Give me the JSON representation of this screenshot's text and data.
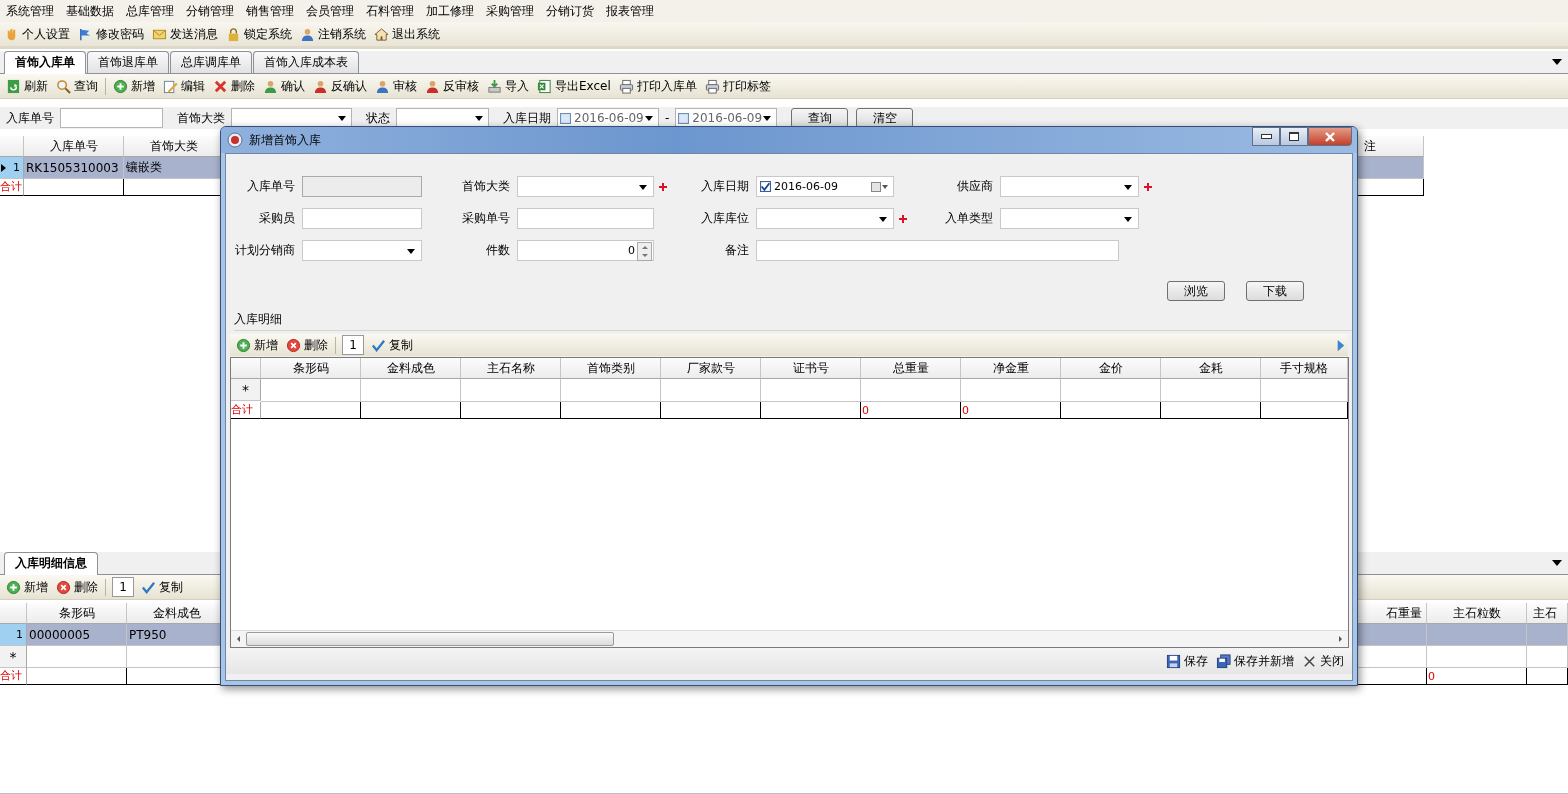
{
  "menu_bar": [
    "系统管理",
    "基础数据",
    "总库管理",
    "分销管理",
    "销售管理",
    "会员管理",
    "石料管理",
    "加工修理",
    "采购管理",
    "分销订货",
    "报表管理"
  ],
  "quick_bar": [
    "个人设置",
    "修改密码",
    "发送消息",
    "锁定系统",
    "注销系统",
    "退出系统"
  ],
  "tabs": [
    {
      "label": "首饰入库单",
      "selected": true
    },
    {
      "label": "首饰退库单",
      "selected": false
    },
    {
      "label": "总库调库单",
      "selected": false
    },
    {
      "label": "首饰入库成本表",
      "selected": false
    }
  ],
  "toolbar": [
    "刷新",
    "查询",
    "新增",
    "编辑",
    "删除",
    "确认",
    "反确认",
    "审核",
    "反审核",
    "导入",
    "导出Excel",
    "打印入库单",
    "打印标签"
  ],
  "filter": {
    "fields": [
      {
        "label": "入库单号",
        "kind": "text"
      },
      {
        "label": "首饰大类",
        "kind": "select"
      },
      {
        "label": "状态",
        "kind": "select"
      },
      {
        "label": "入库日期",
        "kind": "daterange",
        "from": {
          "value": "2016-06-09",
          "checked": false
        },
        "to": {
          "value": "2016-06-09",
          "checked": false
        },
        "separator": "-"
      }
    ],
    "buttons": [
      "查询",
      "清空"
    ]
  },
  "upper_grid": {
    "columns_left": [
      "入库单号",
      "首饰大类"
    ],
    "columns_right": [
      "注"
    ],
    "rows": [
      {
        "number": "1",
        "selected": true,
        "cells": [
          "RK1505310003",
          "镶嵌类"
        ]
      }
    ],
    "total_label": "合计"
  },
  "detail_panel": {
    "tab": "入库明细信息",
    "toolbar": {
      "add": "新增",
      "delete": "删除",
      "count": "1",
      "copy": "复制"
    },
    "columns_left": [
      {
        "label": "条形码"
      },
      {
        "label": "金料成色"
      }
    ],
    "columns_right": [
      {
        "label": "石重量"
      },
      {
        "label": "主石粒数",
        "total": "0"
      },
      {
        "label": "主石"
      }
    ],
    "rows": [
      {
        "number": "1",
        "selected": true,
        "cells": [
          "00000005",
          "PT950"
        ]
      }
    ],
    "new_row_mark": "*",
    "total_label": "合计"
  },
  "dialog": {
    "title": "新增首饰入库",
    "fields": [
      {
        "label": "入库单号",
        "kind": "text",
        "disabled": true,
        "required": false
      },
      {
        "label": "首饰大类",
        "kind": "select",
        "required": true
      },
      {
        "label": "入库日期",
        "kind": "date",
        "value": "2016-06-09",
        "checked": true,
        "required": false
      },
      {
        "label": "供应商",
        "kind": "select",
        "required": true
      },
      {
        "label": "采购员",
        "kind": "text",
        "disabled": false,
        "required": false
      },
      {
        "label": "采购单号",
        "kind": "text",
        "disabled": false,
        "required": false
      },
      {
        "label": "入库库位",
        "kind": "select",
        "required": true
      },
      {
        "label": "入单类型",
        "kind": "select",
        "required": false
      },
      {
        "label": "计划分销商",
        "kind": "select",
        "required": false
      },
      {
        "label": "件数",
        "kind": "number",
        "value": "0",
        "required": false
      },
      {
        "label": "备注",
        "kind": "wide",
        "required": false
      }
    ],
    "buttons": [
      "浏览",
      "下载"
    ],
    "detail": {
      "legend": "入库明细",
      "toolbar": {
        "add": "新增",
        "delete": "删除",
        "count": "1",
        "copy": "复制"
      },
      "columns": [
        {
          "label": "条形码"
        },
        {
          "label": "金料成色"
        },
        {
          "label": "主石名称"
        },
        {
          "label": "首饰类别"
        },
        {
          "label": "厂家款号"
        },
        {
          "label": "证书号"
        },
        {
          "label": "总重量",
          "total": "0"
        },
        {
          "label": "净金重",
          "total": "0"
        },
        {
          "label": "金价"
        },
        {
          "label": "金耗"
        },
        {
          "label": "手寸规格"
        }
      ],
      "new_row_mark": "*",
      "total_label": "合计"
    },
    "footer": [
      "保存",
      "保存并新增",
      "关闭"
    ]
  }
}
